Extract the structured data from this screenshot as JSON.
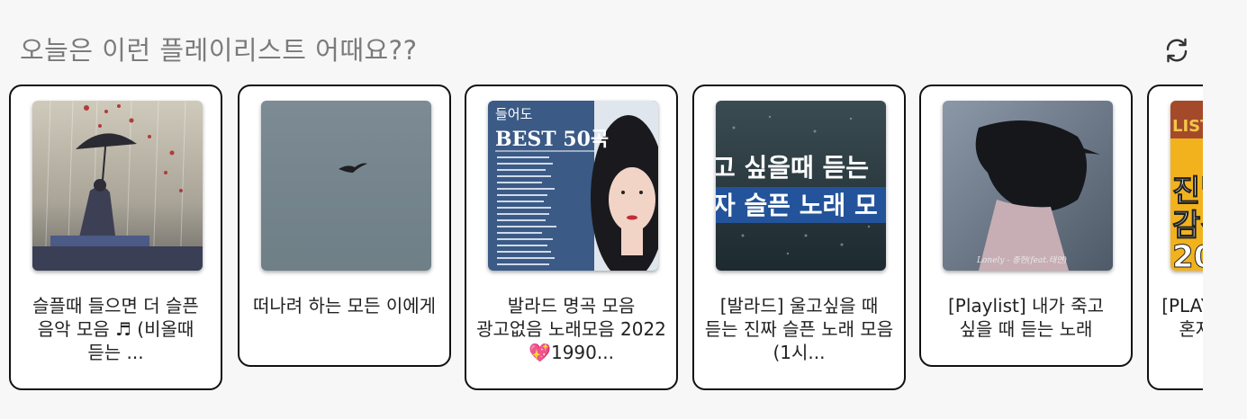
{
  "header": {
    "title": "오늘은 이런 플레이리스트 어때요??",
    "refresh_icon": "refresh-icon"
  },
  "playlists": [
    {
      "title": "슬플때 들으면 더 슬픈 음악 모음 ♬ (비올때 듣는 ...",
      "thumb": "girl-umbrella-art"
    },
    {
      "title": "떠나려 하는 모든 이에게",
      "thumb": "bird-grey-sky"
    },
    {
      "title": "발라드 명곡 모음 광고없음 노래모음 2022💖1990...",
      "thumb": "ballad-best-50",
      "thumb_text_top": "들어도",
      "thumb_text_main": "BEST 50곡"
    },
    {
      "title": "[발라드] 울고싶을 때 듣는 진짜 슬픈 노래 모음(1시...",
      "thumb": "rain-water",
      "thumb_text_line1": "고 싶을때 듣는",
      "thumb_text_line2": "자 슬픈 노래 모"
    },
    {
      "title": "[Playlist] 내가 죽고 싶을 때 듣는 노래",
      "thumb": "dark-hair-woman",
      "thumb_text": "Lonely - 종현(feat.태연)"
    },
    {
      "title": "[PLAYLIST] 비 오는 날, 혼자 듣는 감성 노래",
      "thumb": "yellow-poster",
      "thumb_text_line1": "LIST",
      "thumb_text_line2": "진날",
      "thumb_text_line3": "감성",
      "thumb_text_line4": "20"
    }
  ]
}
